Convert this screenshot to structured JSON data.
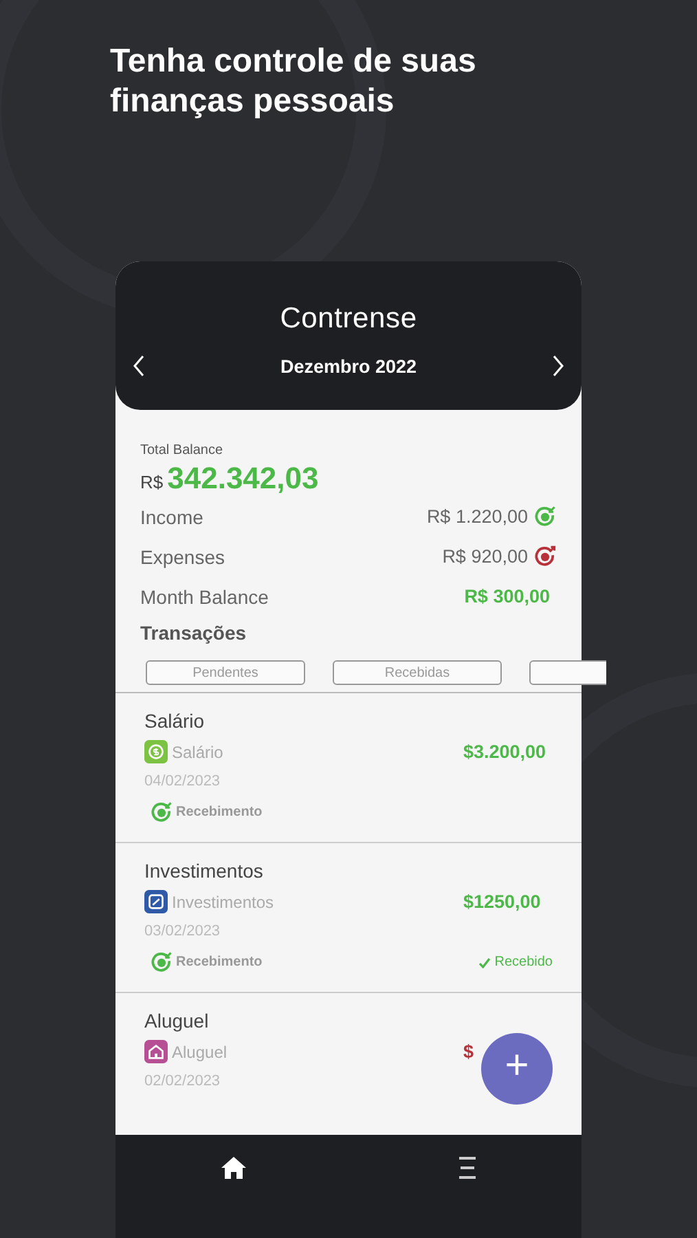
{
  "headline": "Tenha controle de suas finanças pessoais",
  "app": {
    "logo": "Contrense",
    "month": "Dezembro 2022"
  },
  "summary": {
    "label": "Total Balance",
    "currency": "R$",
    "total": "342.342,03",
    "rows": [
      {
        "kind": "income",
        "label": "Income",
        "value": "R$ 1.220,00"
      },
      {
        "kind": "expense",
        "label": "Expenses",
        "value": "R$ 920,00"
      },
      {
        "kind": "balance",
        "label": "Month Balance",
        "value": "R$ 300,00"
      }
    ]
  },
  "section_title": "Transações",
  "filters": [
    {
      "kind": "label",
      "label": "Pendentes"
    },
    {
      "kind": "label",
      "label": "Recebidas"
    },
    {
      "kind": "blank"
    }
  ],
  "transactions": [
    {
      "kind": "income",
      "title": "Salário",
      "category": {
        "kind": "money",
        "label": "Salário",
        "color": "#7cc243"
      },
      "amount": "$3.200,00",
      "date": "04/02/2023",
      "type": "Recebimento"
    },
    {
      "kind": "income",
      "title": "Investimentos",
      "category": {
        "kind": "chart",
        "label": "Investimentos",
        "color": "#2f5aa8"
      },
      "amount": "$1250,00",
      "date": "03/02/2023",
      "type": "Recebimento",
      "status": "Recebido"
    },
    {
      "kind": "expense",
      "title": "Aluguel",
      "category": {
        "kind": "home",
        "label": "Aluguel",
        "color": "#b74f95"
      },
      "amount": "$",
      "date": "02/02/2023"
    }
  ],
  "fab": "+"
}
